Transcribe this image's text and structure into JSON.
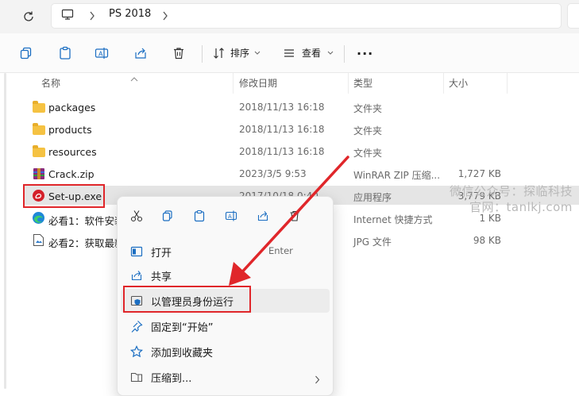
{
  "address_bar": {
    "breadcrumb": [
      "PS 2018"
    ]
  },
  "toolbar": {
    "sort_label": "排序",
    "view_label": "查看",
    "more_label": "..."
  },
  "columns": {
    "name": "名称",
    "modified": "修改日期",
    "type": "类型",
    "size": "大小"
  },
  "files": [
    {
      "name": "packages",
      "modified": "2018/11/13 16:18",
      "type": "文件夹",
      "size": "",
      "icon": "folder-icon"
    },
    {
      "name": "products",
      "modified": "2018/11/13 16:18",
      "type": "文件夹",
      "size": "",
      "icon": "folder-icon"
    },
    {
      "name": "resources",
      "modified": "2018/11/13 16:18",
      "type": "文件夹",
      "size": "",
      "icon": "folder-icon"
    },
    {
      "name": "Crack.zip",
      "modified": "2023/3/5 9:53",
      "type": "WinRAR ZIP 压缩...",
      "size": "1,727 KB",
      "icon": "winrar-archive-icon"
    },
    {
      "name": "Set-up.exe",
      "modified": "2017/10/18 0:40",
      "type": "应用程序",
      "size": "3,779 KB",
      "icon": "adobe-installer-icon"
    },
    {
      "name": "必看1：软件安装",
      "modified": "",
      "type": "Internet 快捷方式",
      "size": "1 KB",
      "icon": "edge-shortcut-icon"
    },
    {
      "name": "必看2：获取最新",
      "modified": "",
      "type": "JPG 文件",
      "size": "98 KB",
      "icon": "image-file-icon"
    }
  ],
  "context_menu": {
    "quick_actions": [
      "cut-icon",
      "copy-icon",
      "paste-icon",
      "rename-icon",
      "share-icon",
      "delete-icon"
    ],
    "items": [
      {
        "label": "打开",
        "shortcut": "Enter",
        "icon": "open-icon"
      },
      {
        "label": "共享",
        "shortcut": "",
        "icon": "share-icon"
      },
      {
        "label": "以管理员身份运行",
        "shortcut": "",
        "icon": "uac-shield-icon"
      },
      {
        "label": "固定到“开始”",
        "shortcut": "",
        "icon": "pin-icon"
      },
      {
        "label": "添加到收藏夹",
        "shortcut": "",
        "icon": "star-icon"
      },
      {
        "label": "压缩到...",
        "shortcut": "",
        "icon": "archive-icon"
      }
    ]
  },
  "watermark": {
    "line1": "微信公众号：探临科技",
    "line2": "官网：tanlkj.com"
  },
  "colors": {
    "annotation_red": "#e0262a",
    "folder_yellow": "#f5c242",
    "selection_gray": "#e5e5e5",
    "accent_blue": "#1b6ec2"
  }
}
